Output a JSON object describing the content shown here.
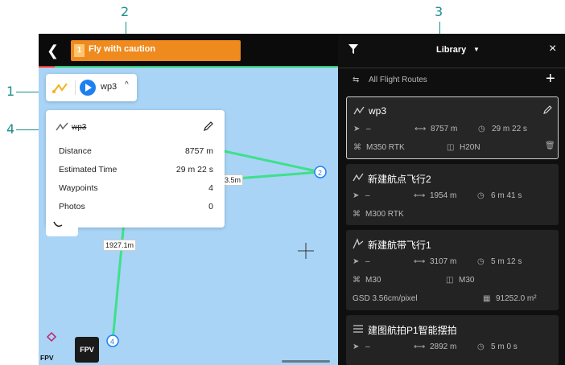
{
  "annotations": {
    "a1": "1",
    "a2": "2",
    "a3": "3",
    "a4": "4"
  },
  "topbar": {
    "back_icon": "chevron-left",
    "warning_number": "1",
    "warning_text": "Fly with caution"
  },
  "route_chip": {
    "name": "wp3",
    "caret": "^"
  },
  "detail": {
    "name": "wp3",
    "rows": [
      {
        "label": "Distance",
        "value": "8757 m"
      },
      {
        "label": "Estimated Time",
        "value": "29 m 22 s"
      },
      {
        "label": "Waypoints",
        "value": "4"
      },
      {
        "label": "Photos",
        "value": "0"
      }
    ]
  },
  "map": {
    "seg1": "1927.1m",
    "seg2": "3.5m",
    "wp2": "2",
    "wp4": "4"
  },
  "fpv": {
    "button": "FPV",
    "label": "FPV"
  },
  "panel": {
    "title": "Library",
    "all_routes": "All Flight Routes",
    "plus": "+",
    "close": "×",
    "routes": [
      {
        "name": "wp3",
        "angle": "–",
        "distance": "8757 m",
        "time": "29 m 22 s",
        "drone": "M350 RTK",
        "camera": "H20N"
      },
      {
        "name": "新建航点飞行2",
        "angle": "–",
        "distance": "1954 m",
        "time": "6 m 41 s",
        "drone": "M300 RTK"
      },
      {
        "name": "新建航带飞行1",
        "angle": "–",
        "distance": "3107 m",
        "time": "5 m 12 s",
        "drone": "M30",
        "camera": "M30",
        "gsd": "GSD 3.56cm/pixel",
        "area": "91252.0 m²"
      },
      {
        "name": "建图航拍P1智能摆拍",
        "angle": "–",
        "distance": "2892 m",
        "time": "5 m 0 s"
      }
    ]
  },
  "colors": {
    "warning": "#ef8a1e",
    "route_line": "#3ee08a",
    "accent": "#1f7ff0",
    "annotation": "#1a8f8a"
  }
}
